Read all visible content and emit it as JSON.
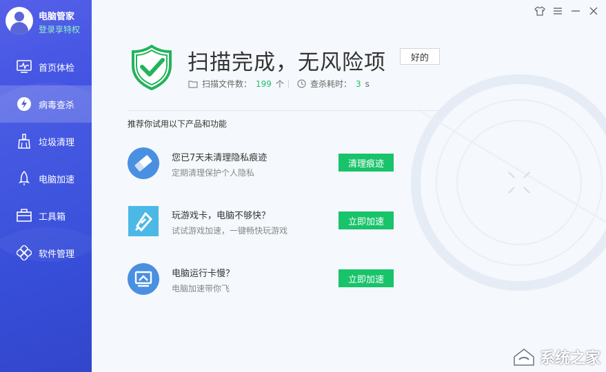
{
  "profile": {
    "app_name": "电脑管家",
    "login_link": "登录享特权"
  },
  "nav": [
    {
      "label": "首页体检",
      "icon": "monitor-pulse-icon",
      "active": false
    },
    {
      "label": "病毒查杀",
      "icon": "virus-scan-icon",
      "active": true
    },
    {
      "label": "垃圾清理",
      "icon": "broom-icon",
      "active": false
    },
    {
      "label": "电脑加速",
      "icon": "rocket-icon",
      "active": false
    },
    {
      "label": "工具箱",
      "icon": "toolbox-icon",
      "active": false
    },
    {
      "label": "软件管理",
      "icon": "software-icon",
      "active": false
    }
  ],
  "window_controls": [
    "skin-icon",
    "menu-icon",
    "minimize-icon",
    "close-icon"
  ],
  "result": {
    "title": "扫描完成，无风险项",
    "ok_button": "好的",
    "files_label": "扫描文件数：",
    "files_value": "199",
    "files_unit": "个",
    "time_label": "查杀耗时：",
    "time_value": "3",
    "time_unit": "s"
  },
  "recommend_title": "推荐你试用以下产品和功能",
  "recommendations": [
    {
      "title": "您已7天未清理隐私痕迹",
      "desc": "定期清理保护个人隐私",
      "button": "清理痕迹",
      "icon": "eraser-icon"
    },
    {
      "title": "玩游戏卡，电脑不够快？",
      "desc": "试试游戏加速，一键畅快玩游戏",
      "button": "立即加速",
      "icon": "game-boost-icon"
    },
    {
      "title": "电脑运行卡慢？",
      "desc": "电脑加速带你飞",
      "button": "立即加速",
      "icon": "screen-boost-icon"
    }
  ],
  "watermark": "系统之家",
  "colors": {
    "sidebar": "#3a4fe0",
    "accent_green": "#18c36a",
    "icon_blue": "#4a90e2"
  }
}
